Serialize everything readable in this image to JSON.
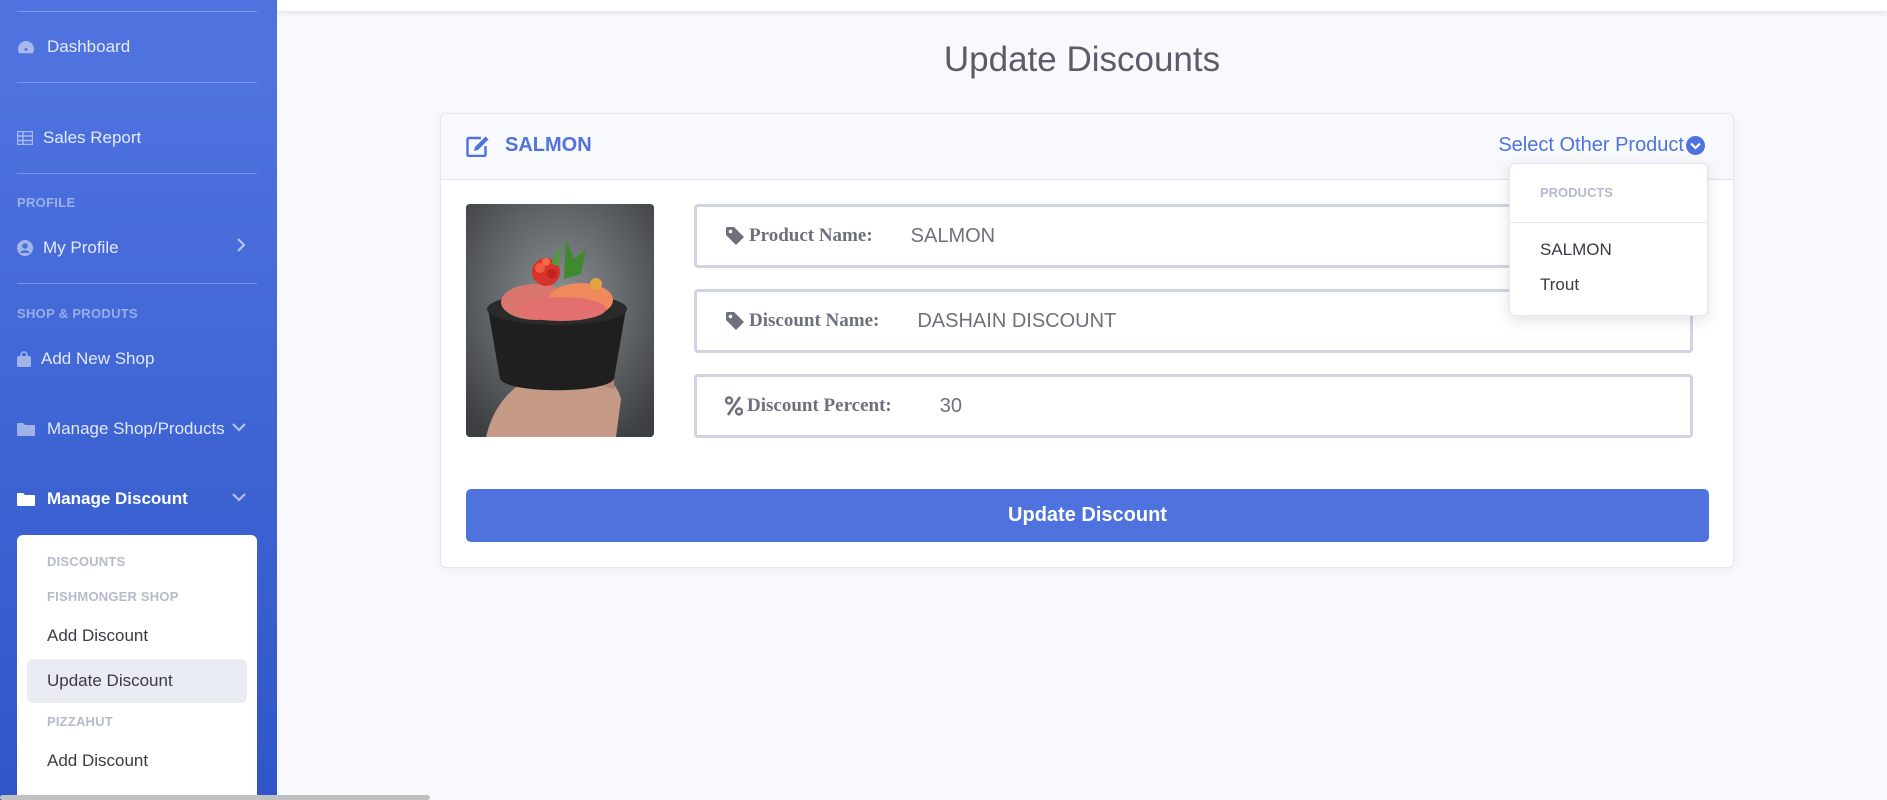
{
  "sidebar": {
    "items": [
      {
        "label": "Dashboard"
      },
      {
        "label": "Sales Report"
      },
      {
        "label": "My Profile"
      },
      {
        "label": "Add New Shop"
      },
      {
        "label": "Manage Shop/Products"
      },
      {
        "label": "Manage Discount"
      }
    ],
    "headings": {
      "profile": "PROFILE",
      "shop": "SHOP & PRODUTS"
    },
    "submenu": {
      "headings": [
        "DISCOUNTS",
        "FISHMONGER SHOP",
        "PIZZAHUT"
      ],
      "items": [
        "Add Discount",
        "Update Discount",
        "Add Discount"
      ]
    }
  },
  "page": {
    "title": "Update Discounts"
  },
  "card": {
    "title": "SALMON",
    "select_other": "Select Other Product",
    "fields": {
      "product_name_label": "Product Name:",
      "product_name_value": "SALMON",
      "discount_name_label": "Discount Name:",
      "discount_name_value": "DASHAIN DISCOUNT",
      "discount_percent_label": "Discount Percent:",
      "discount_percent_value": "30"
    },
    "submit_label": "Update Discount"
  },
  "dropdown": {
    "heading": "PRODUCTS",
    "items": [
      "SALMON",
      "Trout"
    ]
  },
  "colors": {
    "primary": "#4e73df",
    "sidebar_gradient_end": "#2f56c9",
    "background": "#f8f9fc"
  },
  "icons": {
    "dashboard": "tachometer-icon",
    "sales_report": "table-icon",
    "profile": "user-circle-icon",
    "shop": "shopping-bag-icon",
    "folder": "folder-icon",
    "edit": "edit-icon",
    "tag": "tag-icon",
    "percent": "percent-icon",
    "dropdown": "chevron-circle-down-icon"
  }
}
